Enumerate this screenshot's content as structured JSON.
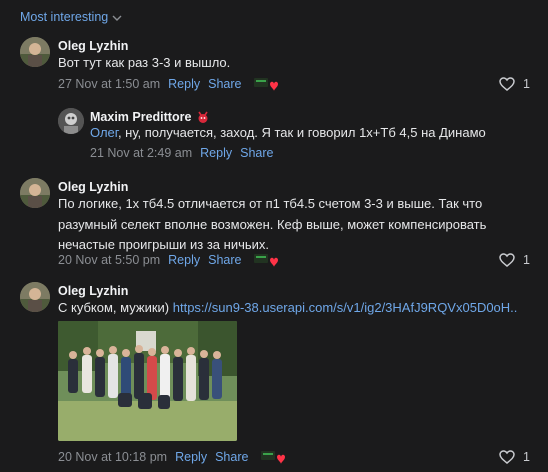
{
  "sort": {
    "label": "Most interesting"
  },
  "comments": [
    {
      "author": "Oleg Lyzhin",
      "text": "Вот тут как раз 3-3 и вышло.",
      "date": "27 Nov at 1:50 am",
      "reply": "Reply",
      "share": "Share",
      "likes": "1"
    },
    {
      "author": "Maxim Predittore",
      "mention": "Олег",
      "text": ", ну, получается, заход. Я так и говорил 1х+Тб 4,5 на Динамо",
      "date": "21 Nov at 2:49 am",
      "reply": "Reply",
      "share": "Share"
    },
    {
      "author": "Oleg Lyzhin",
      "text": "По логике, 1х тб4.5 отличается от п1 тб4.5 счетом 3-3 и выше. Так что разумный селект вполне возможен. Кеф выше, может компенсировать нечастые проигрыши из за ничьих.",
      "date": "20 Nov at 5:50 pm",
      "reply": "Reply",
      "share": "Share",
      "likes": "1"
    },
    {
      "author": "Oleg Lyzhin",
      "text": "С кубком, мужики) ",
      "url": "https://sun9-38.userapi.com/s/v1/ig2/3HAfJ9RQVx05D0oH..",
      "date": "20 Nov at 10:18 pm",
      "reply": "Reply",
      "share": "Share",
      "likes": "1"
    }
  ],
  "colors": {
    "background": "#1b1b1c",
    "link": "#6fa7e8",
    "muted": "#8b8e93",
    "heart": "#ff3347"
  }
}
